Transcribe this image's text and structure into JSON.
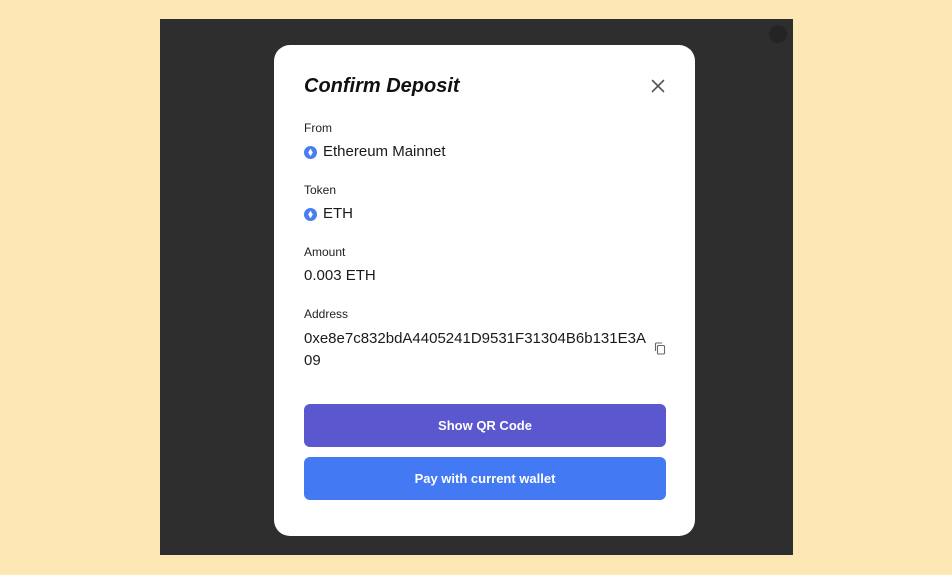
{
  "modal": {
    "title": "Confirm Deposit",
    "fields": {
      "from": {
        "label": "From",
        "value": "Ethereum Mainnet",
        "icon": "ethereum-icon"
      },
      "token": {
        "label": "Token",
        "value": "ETH",
        "icon": "ethereum-icon"
      },
      "amount": {
        "label": "Amount",
        "value": "0.003 ETH"
      },
      "address": {
        "label": "Address",
        "value": "0xe8e7c832bdA4405241D9531F31304B6b131E3A09"
      }
    },
    "buttons": {
      "show_qr": "Show QR Code",
      "pay_wallet": "Pay with current wallet"
    }
  },
  "colors": {
    "page_background": "#fce7b5",
    "overlay": "#2e2e2e",
    "qr_button": "#5b57cf",
    "pay_button": "#4479f4",
    "eth_icon": "#4a7ef0"
  }
}
